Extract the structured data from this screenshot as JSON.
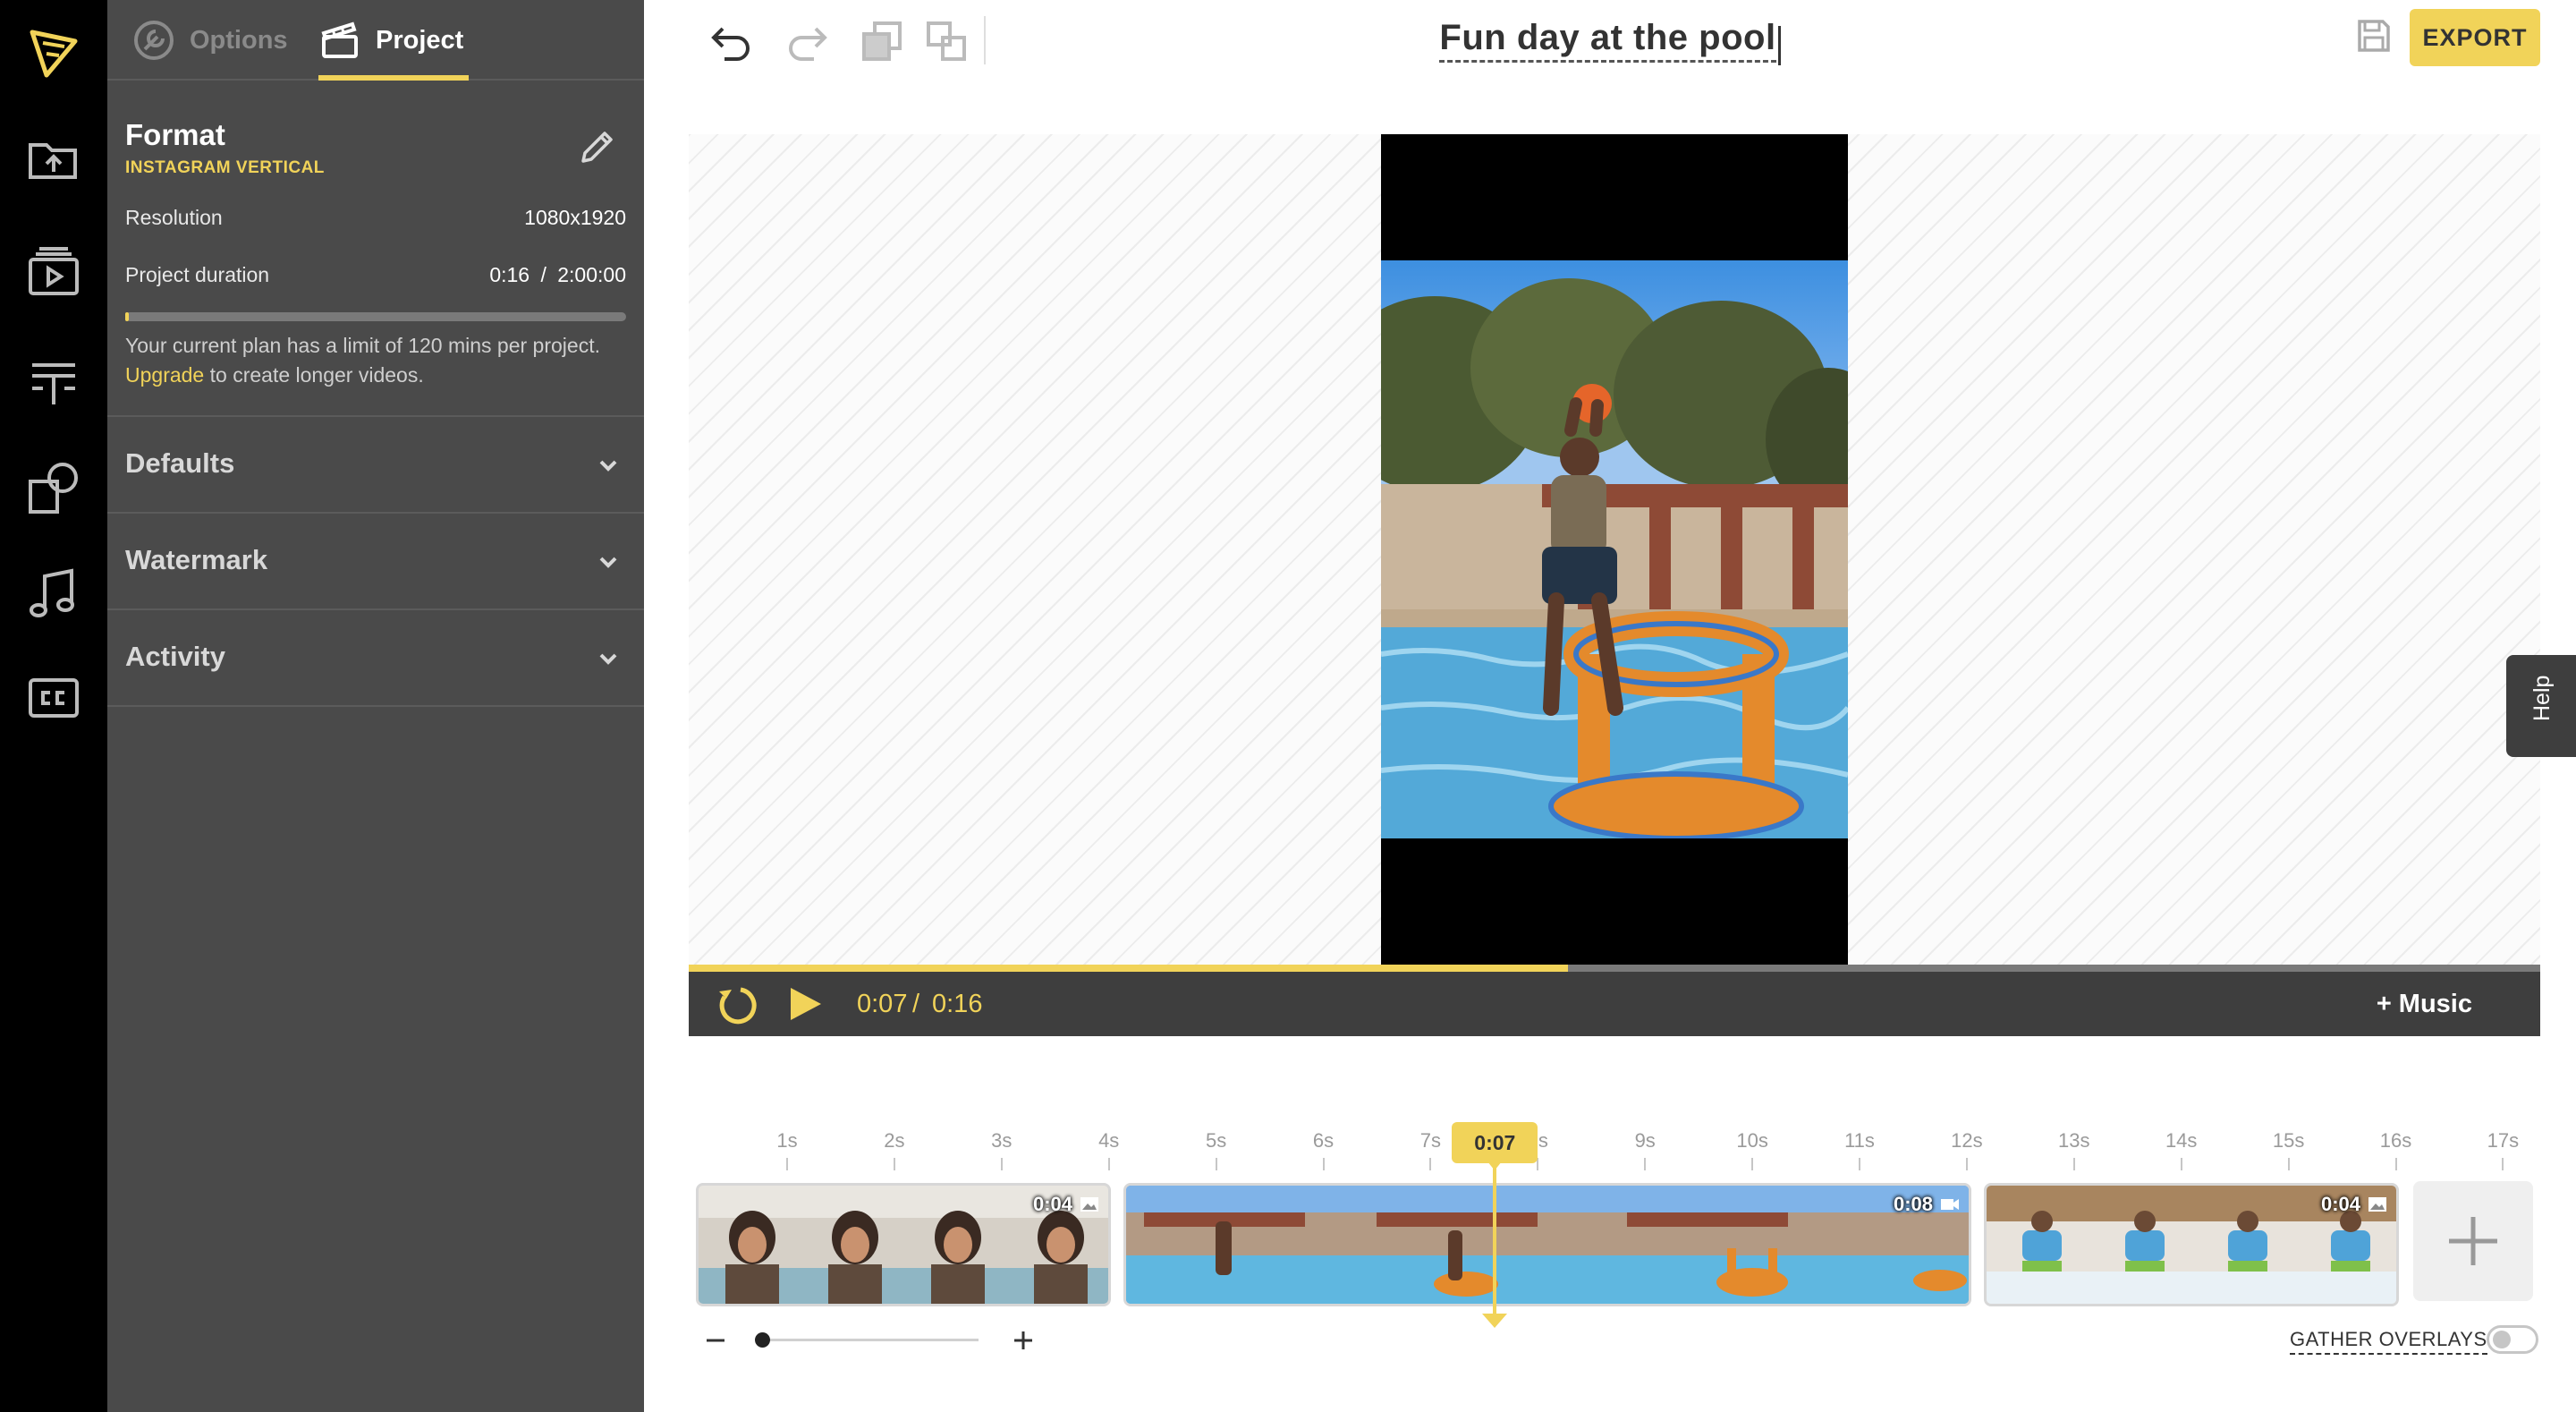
{
  "rail": {
    "items": [
      "logo-icon",
      "upload-icon",
      "media-icon",
      "text-icon",
      "shapes-icon",
      "music-icon",
      "captions-icon"
    ]
  },
  "panel": {
    "tabs": [
      {
        "label": "Options",
        "active": false
      },
      {
        "label": "Project",
        "active": true
      }
    ],
    "format": {
      "title": "Format",
      "subtitle": "INSTAGRAM VERTICAL"
    },
    "resolution": {
      "label": "Resolution",
      "value": "1080x1920"
    },
    "duration": {
      "label": "Project duration",
      "current": "0:16",
      "separator": "/",
      "limit": "2:00:00",
      "fraction": 0.0022
    },
    "plan_note": {
      "prefix": "Your current plan has a limit of 120 mins per project. ",
      "link": "Upgrade",
      "suffix": " to create longer videos."
    },
    "sections": [
      {
        "label": "Defaults"
      },
      {
        "label": "Watermark"
      },
      {
        "label": "Activity"
      }
    ]
  },
  "toolbar": {
    "icons": [
      "undo-icon",
      "redo-icon",
      "send-backward-icon",
      "bring-forward-icon"
    ],
    "project_title": "Fun day at the pool",
    "export_label": "EXPORT"
  },
  "player": {
    "current_time": "0:07",
    "separator": "/",
    "total_time": "0:16",
    "progress": 0.475,
    "music_label": "+ Music"
  },
  "help_label": "Help",
  "timeline": {
    "ticks": [
      "1s",
      "2s",
      "3s",
      "4s",
      "5s",
      "6s",
      "7s",
      "8s",
      "9s",
      "10s",
      "11s",
      "12s",
      "13s",
      "14s",
      "15s",
      "16s",
      "17s"
    ],
    "playhead_label": "0:07",
    "playhead_seconds": 7.6,
    "clips": [
      {
        "duration": "0:04",
        "kind": "image"
      },
      {
        "duration": "0:08",
        "kind": "video"
      },
      {
        "duration": "0:04",
        "kind": "image"
      }
    ],
    "gather_overlays_label": "GATHER OVERLAYS",
    "gather_overlays_on": false
  },
  "colors": {
    "accent": "#f1d359",
    "panel": "#4a4a4a",
    "rail": "#000000",
    "controls": "#3e3e3e"
  }
}
